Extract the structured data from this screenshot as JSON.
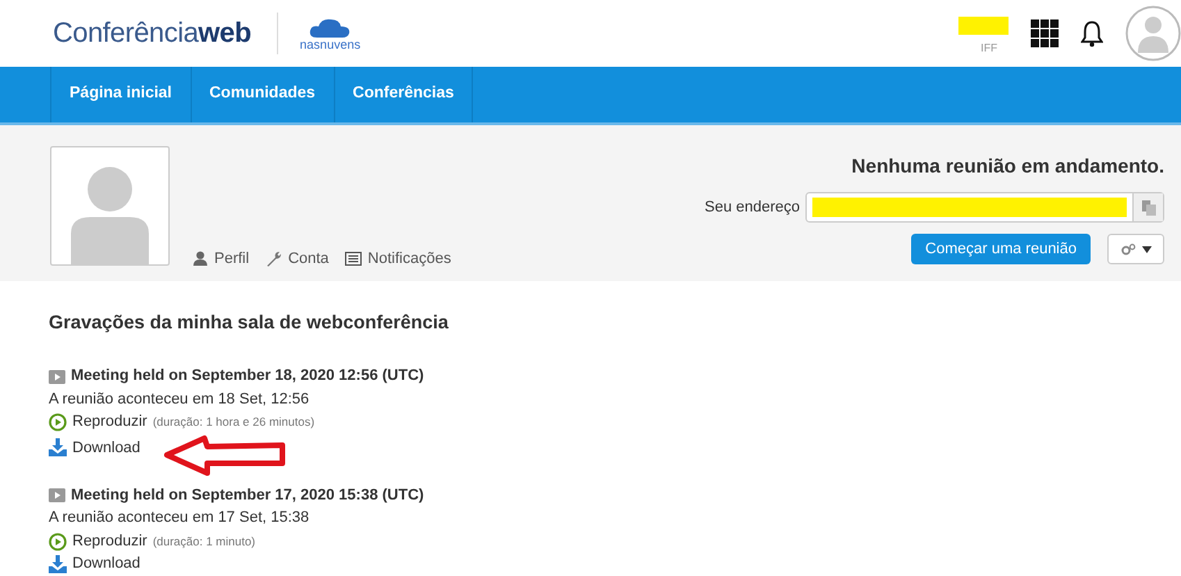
{
  "header": {
    "logo": "Conferência**web**",
    "partner_logo": "nasnuvens",
    "user_org": "IFF"
  },
  "nav": [
    {
      "label": "Página inicial"
    },
    {
      "label": "Comunidades"
    },
    {
      "label": "Conferências"
    }
  ],
  "profile": {
    "links": [
      {
        "kind": "user",
        "label": "Perfil"
      },
      {
        "kind": "wrench",
        "label": "Conta"
      },
      {
        "kind": "list",
        "label": "Notificações"
      }
    ],
    "meeting_status": "Nenhuma reunião em andamento.",
    "address_label": "Seu endereço",
    "start_button": "Começar uma reunião"
  },
  "recordings": {
    "title": "Gravações da minha sala de webconferência",
    "items": [
      {
        "title": "Meeting held on September 18, 2020 12:56 (UTC)",
        "held": "A reunião aconteceu em 18 Set, 12:56",
        "play": "Reproduzir",
        "duration": "(duração: 1 hora e 26 minutos)",
        "download": "Download",
        "highlighted": true
      },
      {
        "title": "Meeting held on September 17, 2020 15:38 (UTC)",
        "held": "A reunião aconteceu em 17 Set, 15:38",
        "play": "Reproduzir",
        "duration": "(duração: 1 minuto)",
        "download": "Download",
        "highlighted": false
      }
    ]
  }
}
